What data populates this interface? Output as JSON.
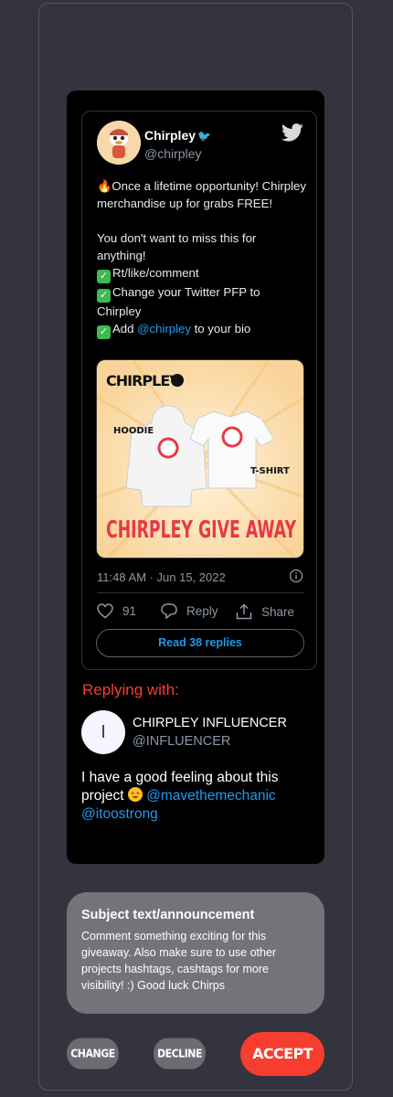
{
  "tweet": {
    "name": "Chirpley",
    "handle": "@chirpley",
    "text_line_1": "🔥Once a lifetime opportunity! Chirpley merchandise up for grabs FREE!",
    "text_line_2": "You don't want to miss this for anything!",
    "check_1": "Rt/like/comment",
    "check_2": "Change your Twitter PFP to Chirpley",
    "check_3_prefix": "Add ",
    "check_3_mention": "@chirpley",
    "check_3_suffix": " to your bio",
    "image": {
      "brand": "CHIRPLEY",
      "hoodie_label": "HOODIE",
      "tshirt_label": "T-SHIRT",
      "banner": "CHIRPLEY GIVE AWAY"
    },
    "timestamp": "11:48 AM · Jun 15, 2022",
    "likes": "91",
    "reply_label": "Reply",
    "share_label": "Share",
    "read_replies": "Read 38 replies"
  },
  "reply": {
    "heading": "Replying with:",
    "avatar_initial": "I",
    "name": "CHIRPLEY INFLUENCER",
    "handle": "@INFLUENCER",
    "text": "I have a good feeling about this project",
    "mention_1": "@mavethemechanic",
    "mention_2": "@itoostrong"
  },
  "subject": {
    "title": "Subject text/announcement",
    "body": "Comment something exciting for this giveaway. Also make sure to use other projects hashtags, cashtags for more visibility! :) Good luck Chirps"
  },
  "buttons": {
    "change": "CHANGE",
    "decline": "DECLINE",
    "accept": "ACCEPT"
  },
  "colors": {
    "accent": "#f63d2f",
    "link": "#1d9bf0",
    "background": "#33333d"
  }
}
